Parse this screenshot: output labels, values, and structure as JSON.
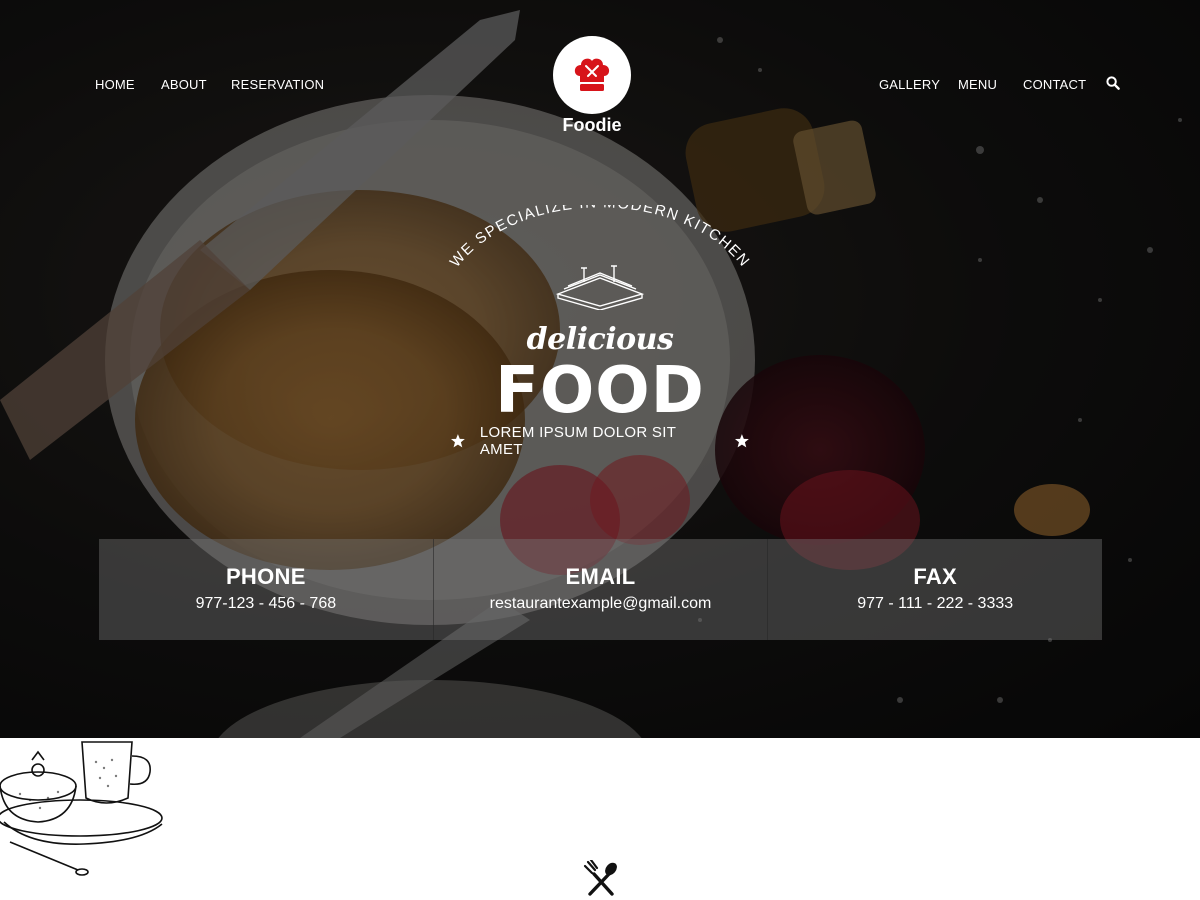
{
  "nav": {
    "left": [
      {
        "label": "HOME"
      },
      {
        "label": "ABOUT"
      },
      {
        "label": "RESERVATION"
      }
    ],
    "right": [
      {
        "label": "GALLERY"
      },
      {
        "label": "MENU"
      },
      {
        "label": "CONTACT"
      }
    ],
    "search_icon": "search-icon"
  },
  "logo": {
    "name": "Foodie",
    "icon": "chef-hat-icon",
    "accent": "#d7141a"
  },
  "hero": {
    "arc_text": "WE SPECIALIZE IN MODERN KITCHEN",
    "script": "delicious",
    "title": "FOOD",
    "tagline": "LOREM IPSUM DOLOR SIT AMET"
  },
  "contact": [
    {
      "label": "PHONE",
      "value": "977-123 - 456 - 768"
    },
    {
      "label": "EMAIL",
      "value": "restaurantexample@gmail.com"
    },
    {
      "label": "FAX",
      "value": "977 - 111 - 222 - 3333"
    }
  ],
  "below": {
    "divider_icon": "utensils-icon",
    "sketch_icon": "teapot-sketch-icon"
  }
}
